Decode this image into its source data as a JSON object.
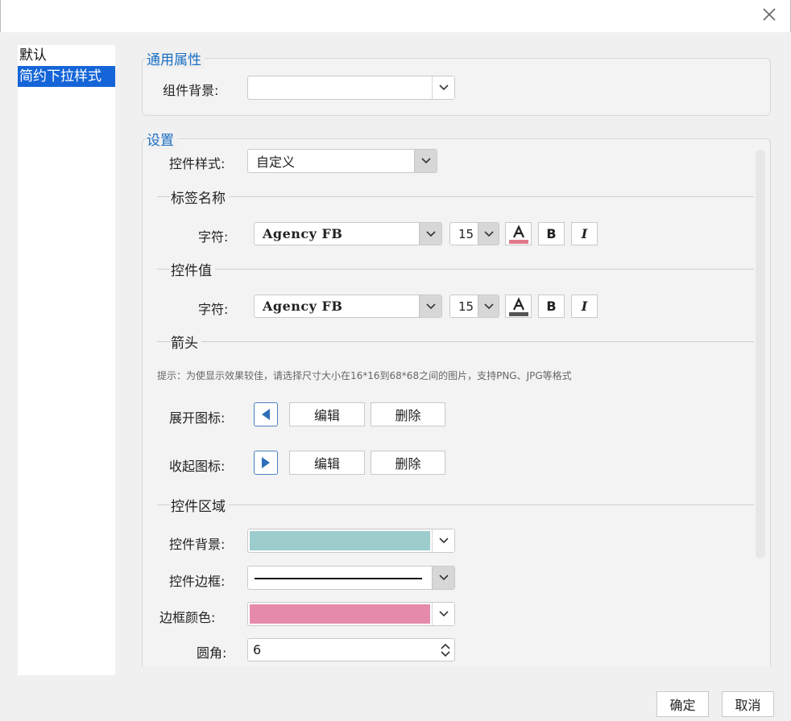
{
  "left_list": {
    "items": [
      {
        "label": "默认",
        "selected": false
      },
      {
        "label": "简约下拉样式",
        "selected": true
      }
    ]
  },
  "general": {
    "title": "通用属性",
    "component_bg_label": "组件背景:"
  },
  "settings": {
    "title": "设置",
    "control_style_label": "控件样式:",
    "control_style_value": "自定义",
    "label_name": {
      "section": "标签名称",
      "char_label": "字符:",
      "font": "Agency FB",
      "size": "15",
      "font_color": "#e07a8a",
      "bold_label": "B",
      "italic_label": "I"
    },
    "control_value": {
      "section": "控件值",
      "char_label": "字符:",
      "font": "Agency FB",
      "size": "15",
      "font_color": "#555555",
      "bold_label": "B",
      "italic_label": "I"
    },
    "arrow": {
      "section": "箭头",
      "hint": "提示：为使显示效果较佳，请选择尺寸大小在16*16到68*68之间的图片，支持PNG、JPG等格式",
      "expand_label": "展开图标:",
      "collapse_label": "收起图标:",
      "edit_label": "编辑",
      "delete_label": "删除",
      "icon_color": "#2e6fba"
    },
    "control_area": {
      "section": "控件区域",
      "bg_label": "控件背景:",
      "bg_color": "#9ccccc",
      "border_label": "控件边框:",
      "border_color_label": "边框颜色:",
      "border_color": "#e58aab",
      "radius_label": "圆角:",
      "radius_value": "6"
    }
  },
  "footer": {
    "ok_label": "确定",
    "cancel_label": "取消"
  }
}
